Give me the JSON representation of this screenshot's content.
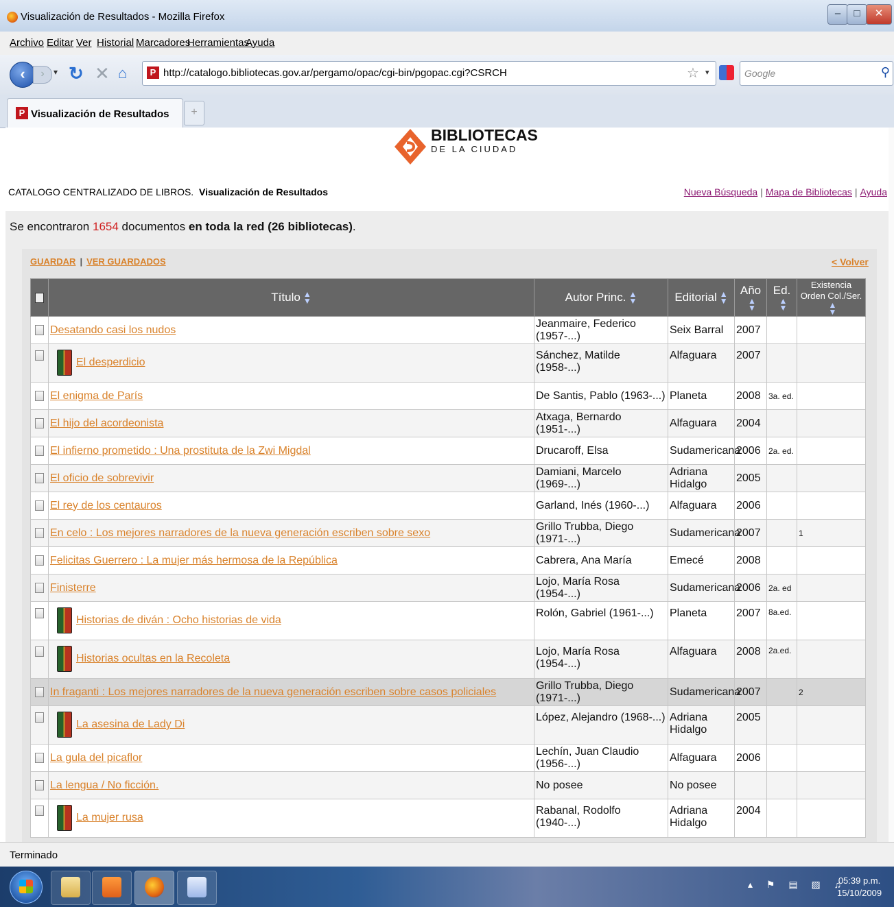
{
  "window": {
    "title": "Visualización de Resultados - Mozilla Firefox"
  },
  "menu": [
    "Archivo",
    "Editar",
    "Ver",
    "Historial",
    "Marcadores",
    "Herramientas",
    "Ayuda"
  ],
  "navbar": {
    "url": "http://catalogo.bibliotecas.gov.ar/pergamo/opac/cgi-bin/pgopac.cgi?CSRCH",
    "search_placeholder": "Google"
  },
  "tab": {
    "label": "Visualización de Resultados",
    "new_tab": "+"
  },
  "page": {
    "logo_line1": "BIBLIOTECAS",
    "logo_line2": "DE LA CIUDAD",
    "catalog_title": "CATALOGO CENTRALIZADO DE LIBROS.",
    "view_title": "Visualización de Resultados",
    "links": {
      "new_search": "Nueva Búsqueda",
      "map": "Mapa de Bibliotecas",
      "help": "Ayuda"
    },
    "found_prefix": "Se encontraron",
    "found_count": "1654",
    "found_mid": "documentos",
    "found_suffix": "en toda la red (26 bibliotecas)",
    "found_end": ".",
    "save": "GUARDAR",
    "view_saved": "VER GUARDADOS",
    "back": "< Volver"
  },
  "table": {
    "headers": {
      "title": "Título",
      "author": "Autor Princ.",
      "publisher": "Editorial",
      "year": "Año",
      "edition": "Ed.",
      "stock_line1": "Existencia",
      "stock_line2": "Orden Col./Ser."
    },
    "rows": [
      {
        "title": "Desatando casi los nudos",
        "author": "Jeanmaire, Federico (1957-...)",
        "publisher": "Seix Barral",
        "year": "2007",
        "edition": "",
        "order": "",
        "icon": false
      },
      {
        "title": "El desperdicio",
        "author": "Sánchez, Matilde (1958-...)",
        "publisher": "Alfaguara",
        "year": "2007",
        "edition": "",
        "order": "",
        "icon": true
      },
      {
        "title": "El enigma de París",
        "author": "De Santis, Pablo (1963-...)",
        "publisher": "Planeta",
        "year": "2008",
        "edition": "3a. ed.",
        "order": "",
        "icon": false
      },
      {
        "title": "El hijo del acordeonista",
        "author": "Atxaga, Bernardo (1951-...)",
        "publisher": "Alfaguara",
        "year": "2004",
        "edition": "",
        "order": "",
        "icon": false
      },
      {
        "title": "El infierno prometido : Una prostituta de la Zwi Migdal",
        "author": "Drucaroff, Elsa",
        "publisher": "Sudamericana",
        "year": "2006",
        "edition": "2a. ed.",
        "order": "",
        "icon": false
      },
      {
        "title": "El oficio de sobrevivir",
        "author": "Damiani, Marcelo (1969-...)",
        "publisher": "Adriana Hidalgo",
        "year": "2005",
        "edition": "",
        "order": "",
        "icon": false
      },
      {
        "title": "El rey de los centauros",
        "author": "Garland, Inés (1960-...)",
        "publisher": "Alfaguara",
        "year": "2006",
        "edition": "",
        "order": "",
        "icon": false
      },
      {
        "title": "En celo : Los mejores narradores de la nueva generación escriben sobre sexo",
        "author": "Grillo Trubba, Diego (1971-...)",
        "publisher": "Sudamericana",
        "year": "2007",
        "edition": "",
        "order": "1",
        "icon": false
      },
      {
        "title": "Felicitas Guerrero : La mujer más hermosa de la República",
        "author": "Cabrera, Ana María",
        "publisher": "Emecé",
        "year": "2008",
        "edition": "",
        "order": "",
        "icon": false
      },
      {
        "title": "Finisterre",
        "author": "Lojo, María Rosa (1954-...)",
        "publisher": "Sudamericana",
        "year": "2006",
        "edition": "2a. ed",
        "order": "",
        "icon": false
      },
      {
        "title": "Historias de diván : Ocho historias de vida",
        "author": "Rolón, Gabriel (1961-...)",
        "publisher": "Planeta",
        "year": "2007",
        "edition": "8a.ed.",
        "order": "",
        "icon": true
      },
      {
        "title": "Historias ocultas en la Recoleta",
        "author": "Lojo, María Rosa (1954-...)",
        "publisher": "Alfaguara",
        "year": "2008",
        "edition": "2a.ed.",
        "order": "",
        "icon": true
      },
      {
        "title": "In fraganti : Los mejores narradores de la nueva generación escriben sobre casos policiales",
        "author": "Grillo Trubba, Diego (1971-...)",
        "publisher": "Sudamericana",
        "year": "2007",
        "edition": "",
        "order": "2",
        "icon": false
      },
      {
        "title": "La asesina de Lady Di",
        "author": "López, Alejandro (1968-...)",
        "publisher": "Adriana Hidalgo",
        "year": "2005",
        "edition": "",
        "order": "",
        "icon": true
      },
      {
        "title": "La gula del picaflor",
        "author": "Lechín, Juan Claudio (1956-...)",
        "publisher": "Alfaguara",
        "year": "2006",
        "edition": "",
        "order": "",
        "icon": false
      },
      {
        "title": "La lengua / No ficción.",
        "author": "No posee",
        "publisher": "No posee",
        "year": "",
        "edition": "",
        "order": "",
        "icon": false
      },
      {
        "title": "La mujer rusa",
        "author": "Rabanal, Rodolfo (1940-...)",
        "publisher": "Adriana Hidalgo",
        "year": "2004",
        "edition": "",
        "order": "",
        "icon": true
      }
    ]
  },
  "status": {
    "text": "Terminado"
  },
  "taskbar": {
    "time": "05:39 p.m.",
    "date": "15/10/2009"
  },
  "colors": {
    "link_orange": "#d9822b",
    "header_gray": "#666666",
    "count_red": "#d02020",
    "nav_purple": "#8a1670"
  }
}
